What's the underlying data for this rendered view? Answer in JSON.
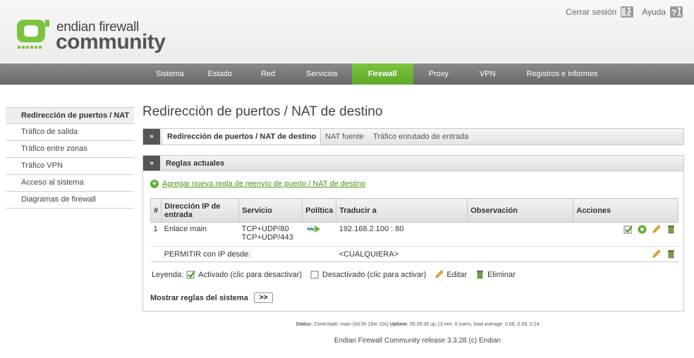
{
  "brand": {
    "line1": "endian firewall",
    "line2": "community",
    "color": "#7cc440"
  },
  "top_links": {
    "logout": "Cerrar sesión",
    "help": "Ayuda"
  },
  "nav": {
    "items": [
      "Sistema",
      "Estado",
      "Red",
      "Servicios",
      "Firewall",
      "Proxy",
      "VPN",
      "Registros e informes"
    ],
    "active": "Firewall"
  },
  "sidebar": {
    "items": [
      "Redirección de puertos / NAT",
      "Tráfico de salida",
      "Tráfico entre zonas",
      "Tráfico VPN",
      "Acceso al sistema",
      "Diagramas de firewall"
    ],
    "active": "Redirección de puertos / NAT"
  },
  "page_title": "Redirección de puertos / NAT de destino",
  "tabs": {
    "arrow": "»",
    "items": [
      "Redirección de puertos / NAT de destino",
      "NAT fuente",
      "Tráfico enrutado de entrada"
    ]
  },
  "box": {
    "arrow": "»",
    "title": "Reglas actuales",
    "add_link": "Agregar nueva regla de reenvío de puerto / NAT de destino",
    "table": {
      "headers": [
        "#",
        "Dirección IP de entrada",
        "Servicio",
        "Política",
        "Traducir a",
        "Observación",
        "Acciones"
      ],
      "rule": {
        "num": "1",
        "entry": "Enlace main",
        "service_line1": "TCP+UDP/80",
        "service_line2": "TCP+UDP/443",
        "policy_icon": "arrow-right-icon",
        "translate": "192.168.2.100 : 80",
        "observation": ""
      },
      "allow_row": {
        "label": "PERMITIR con IP desde:",
        "translate": "<CUALQUIERA>"
      }
    },
    "legend": {
      "label": "Leyenda:",
      "enabled": "Activado (clic para desactivar)",
      "disabled": "Desactivado (clic para activar)",
      "edit": "Editar",
      "delete": "Eliminar"
    },
    "system_rules": {
      "label": "Mostrar reglas del sistema",
      "button": ">>"
    }
  },
  "footer": {
    "status_label": "Status:",
    "status_text": "Conectado: main (0d 5h 16m 10s)",
    "uptime_label": "Uptime:",
    "uptime_text": "05:35:35 up 13 min, 0 users, load average: 0.06, 0.09, 0.14",
    "release": "Endian Firewall Community release 3.3.28 (c) Endian"
  }
}
